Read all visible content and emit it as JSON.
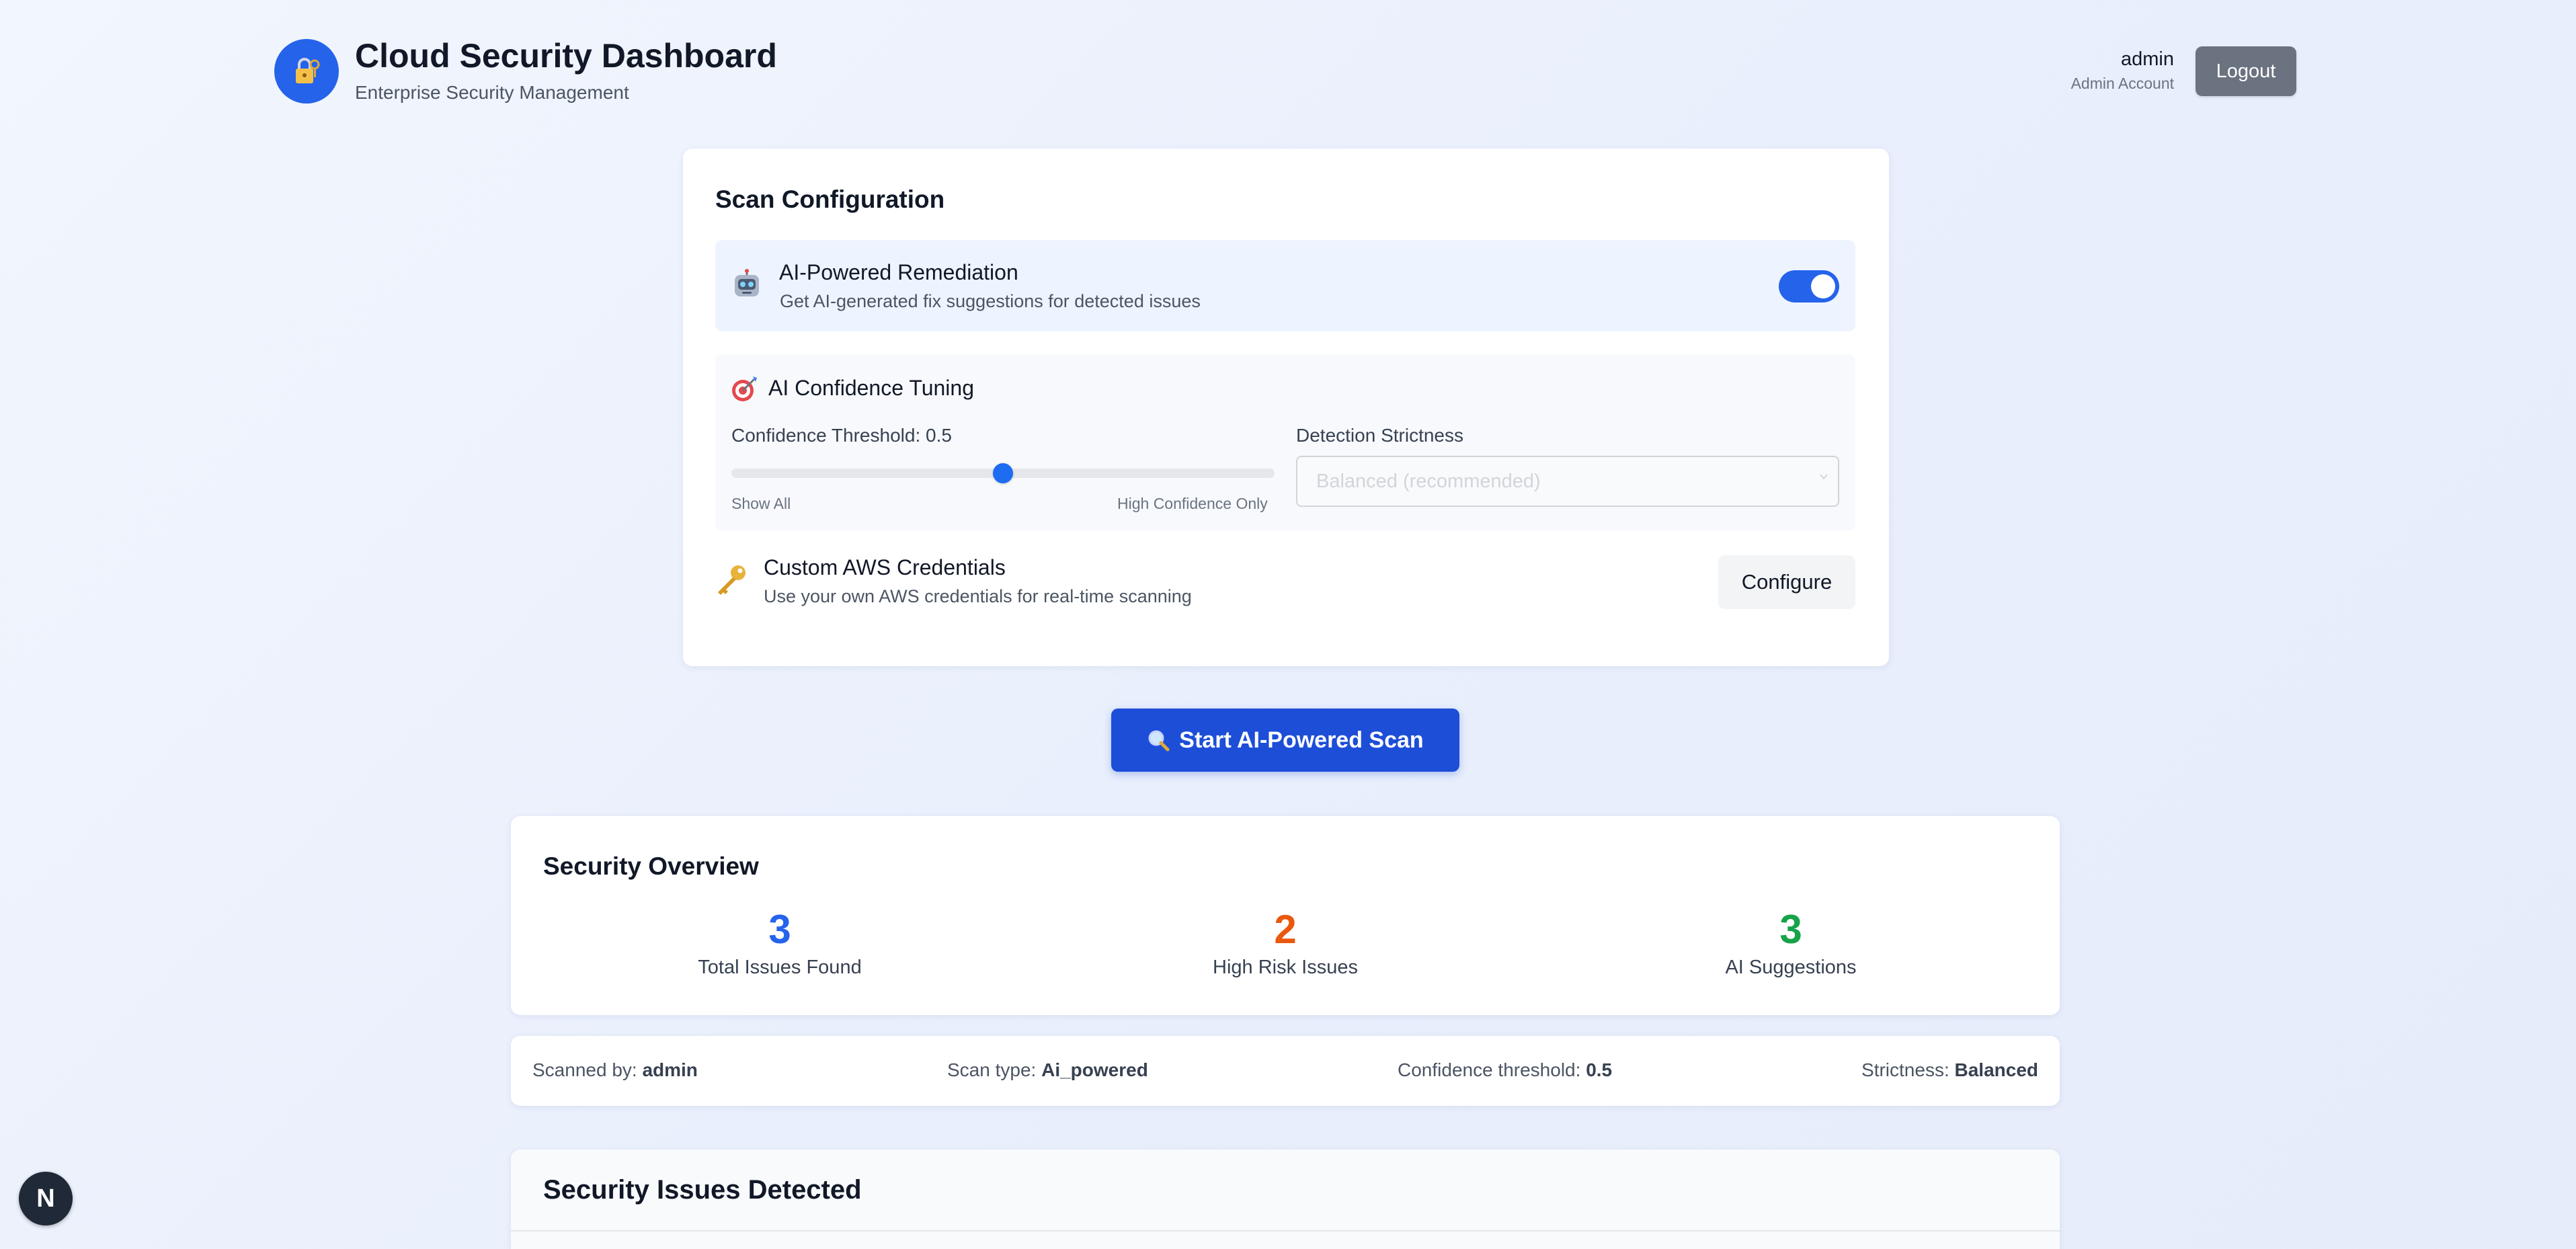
{
  "header": {
    "title": "Cloud Security Dashboard",
    "subtitle": "Enterprise Security Management",
    "logo_icon": "lock-key-icon",
    "user": {
      "name": "admin",
      "role": "Admin Account"
    },
    "logout_label": "Logout"
  },
  "scan_config": {
    "heading": "Scan Configuration",
    "ai_remediation": {
      "icon": "robot-icon",
      "title": "AI-Powered Remediation",
      "description": "Get AI-generated fix suggestions for detected issues",
      "enabled": true
    },
    "tuning": {
      "icon": "target-icon",
      "title": "AI Confidence Tuning",
      "threshold_label": "Confidence Threshold: 0.5",
      "threshold_value": 0.5,
      "slider_min_label": "Show All",
      "slider_max_label": "High Confidence Only",
      "strictness_label": "Detection Strictness",
      "strictness_selected": "Balanced (recommended)"
    },
    "aws_credentials": {
      "icon": "key-icon",
      "title": "Custom AWS Credentials",
      "description": "Use your own AWS credentials for real-time scanning",
      "button_label": "Configure"
    }
  },
  "scan_button": {
    "icon": "magnifier-icon",
    "label": "Start AI-Powered Scan"
  },
  "overview": {
    "heading": "Security Overview",
    "stats": [
      {
        "value": "3",
        "label": "Total Issues Found",
        "color": "#2563eb"
      },
      {
        "value": "2",
        "label": "High Risk Issues",
        "color": "#ea580c"
      },
      {
        "value": "3",
        "label": "AI Suggestions",
        "color": "#16a34a"
      }
    ]
  },
  "scan_meta": {
    "scanned_by_label": "Scanned by:",
    "scanned_by": "admin",
    "scan_type_label": "Scan type:",
    "scan_type": "Ai_powered",
    "threshold_label": "Confidence threshold:",
    "threshold": "0.5",
    "strictness_label": "Strictness:",
    "strictness": "Balanced"
  },
  "issues": {
    "heading": "Security Issues Detected"
  },
  "dev_badge": {
    "letter": "N"
  },
  "colors": {
    "primary": "#2563eb",
    "button_dark_blue": "#1d4ed8",
    "logout_gray": "#6b7280",
    "high_risk": "#ea580c",
    "success": "#16a34a"
  }
}
